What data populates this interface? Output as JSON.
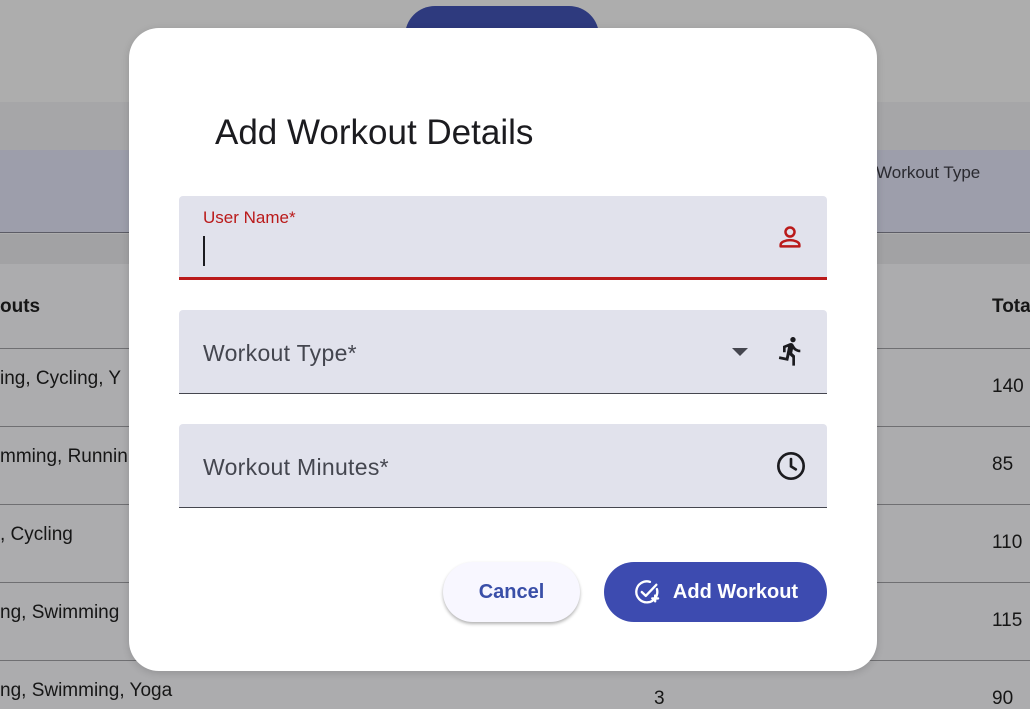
{
  "background": {
    "table_header": {
      "workouts_col": "outs",
      "workout_type_col": "Workout Type",
      "total_col": "Tota"
    },
    "rows": [
      {
        "workouts": "ing, Cycling, Y",
        "count": "",
        "total": "140"
      },
      {
        "workouts": "mming, Runnin",
        "count": "",
        "total": "85"
      },
      {
        "workouts": ", Cycling",
        "count": "",
        "total": "110"
      },
      {
        "workouts": "ng, Swimming",
        "count": "",
        "total": "115"
      },
      {
        "workouts": "ng, Swimming, Yoga",
        "count": "3",
        "total": "90"
      }
    ]
  },
  "dialog": {
    "title": "Add Workout Details",
    "fields": {
      "user_name": {
        "label": "User Name*",
        "value": "",
        "icon": "person-icon"
      },
      "workout_type": {
        "label": "Workout Type*",
        "value": "",
        "icon": "directions-run-icon"
      },
      "workout_minutes": {
        "label": "Workout Minutes*",
        "value": "",
        "icon": "clock-icon"
      }
    },
    "buttons": {
      "cancel": "Cancel",
      "add": "Add Workout"
    }
  },
  "colors": {
    "accent": "#3d4bb0",
    "error": "#ba1a1a",
    "field_bg": "#e1e2ec"
  }
}
